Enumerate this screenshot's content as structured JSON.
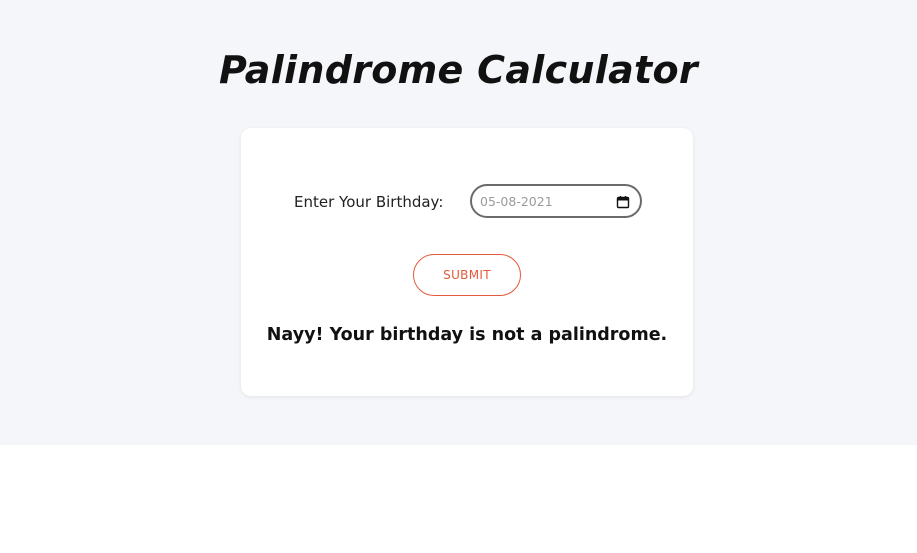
{
  "header": {
    "title": "Palindrome Calculator"
  },
  "form": {
    "birthday_label": "Enter Your Birthday:",
    "birthday_value": "05-08-2021",
    "submit_label": "SUBMIT",
    "calendar_icon": "calendar-icon"
  },
  "result": {
    "message": "Nayy! Your birthday is not a palindrome."
  },
  "colors": {
    "background": "#f5f6fa",
    "card": "#ffffff",
    "accent": "#e45a3c",
    "text": "#111111"
  }
}
